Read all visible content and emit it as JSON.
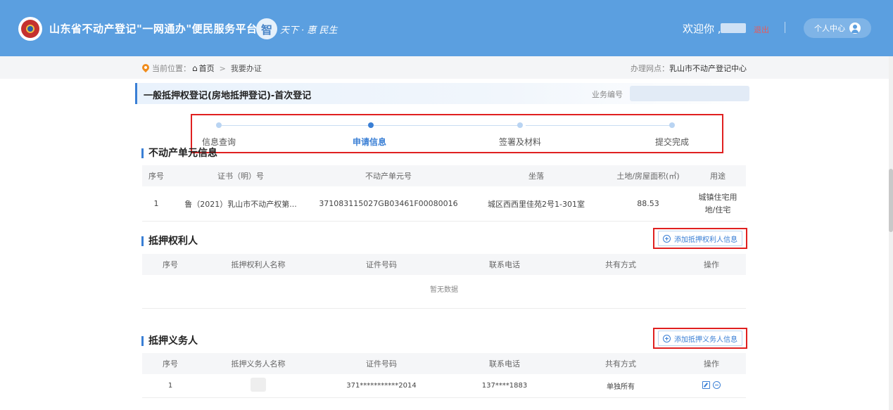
{
  "header": {
    "site_title": "山东省不动产登记\"一网通办\"便民服务平台",
    "slogan_char": "智",
    "slogan_text": "天下 · 惠 民生",
    "welcome": "欢迎你 ,",
    "logout": "退出",
    "personal_center": "个人中心"
  },
  "breadcrumb": {
    "prefix": "当前位置：",
    "home": "首页",
    "separator": ">",
    "current": "我要办证",
    "office_label": "办理网点：",
    "office_name": "乳山市不动产登记中心"
  },
  "page": {
    "title": "一般抵押权登记(房地抵押登记)-首次登记",
    "business_no_label": "业务编号"
  },
  "steps": [
    {
      "label": "信息查询",
      "active": false
    },
    {
      "label": "申请信息",
      "active": true
    },
    {
      "label": "签署及材料",
      "active": false
    },
    {
      "label": "提交完成",
      "active": false
    }
  ],
  "property_section": {
    "title": "不动产单元信息",
    "columns": [
      "序号",
      "证书（明）号",
      "不动产单元号",
      "坐落",
      "土地/房屋面积(㎡)",
      "用途"
    ],
    "rows": [
      {
        "no": "1",
        "cert_no": "鲁（2021）乳山市不动产权第...",
        "unit_no": "371083115027GB03461F00080016",
        "location": "城区西西里佳苑2号1-301室",
        "area": "88.53",
        "usage": "城镇住宅用地/住宅"
      }
    ]
  },
  "mortgagee_section": {
    "title": "抵押权利人",
    "add_button": "添加抵押权利人信息",
    "columns": [
      "序号",
      "抵押权利人名称",
      "证件号码",
      "联系电话",
      "共有方式",
      "操作"
    ],
    "empty_text": "暂无数据"
  },
  "mortgagor_section": {
    "title": "抵押义务人",
    "add_button": "添加抵押义务人信息",
    "columns": [
      "序号",
      "抵押义务人名称",
      "证件号码",
      "联系电话",
      "共有方式",
      "操作"
    ],
    "rows": [
      {
        "no": "1",
        "id_no": "371***********2014",
        "phone": "137****1883",
        "share_type": "单独所有"
      }
    ]
  },
  "colors": {
    "header_bg": "#5b9fe0",
    "accent": "#3a7fd5",
    "highlight_border": "#e02020"
  }
}
